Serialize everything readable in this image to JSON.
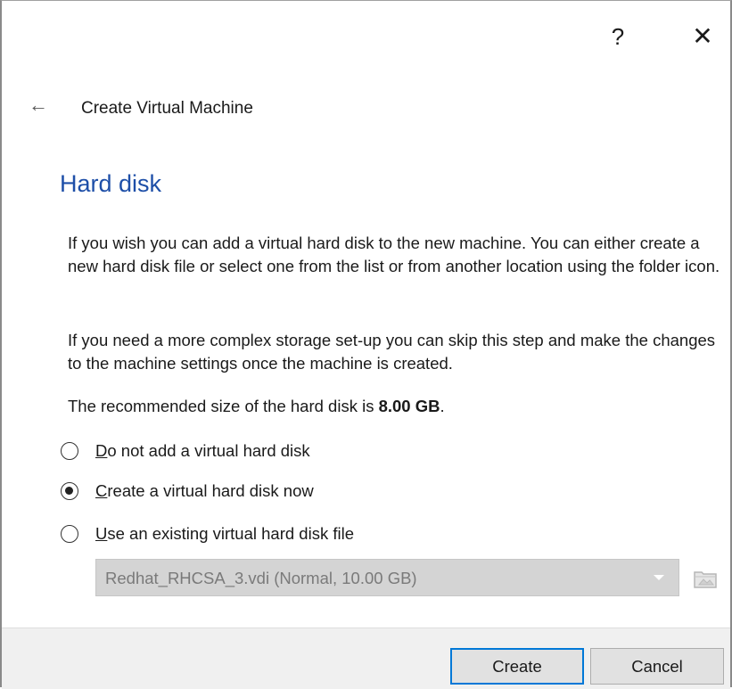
{
  "titlebar": {
    "help_label": "?",
    "close_label": "✕"
  },
  "wizard": {
    "back_icon": "←",
    "title": "Create Virtual Machine"
  },
  "page": {
    "section_title": "Hard disk",
    "paragraph1": "If you wish you can add a virtual hard disk to the new machine. You can either create a new hard disk file or select one from the list or from another location using the folder icon.",
    "paragraph2": "If you need a more complex storage set-up you can skip this step and make the changes to the machine settings once the machine is created.",
    "recommend_prefix": "The recommended size of the hard disk is ",
    "recommend_size": "8.00 GB",
    "recommend_suffix": "."
  },
  "options": [
    {
      "mnemonic": "D",
      "rest": "o not add a virtual hard disk",
      "checked": false
    },
    {
      "mnemonic": "C",
      "rest": "reate a virtual hard disk now",
      "checked": true
    },
    {
      "mnemonic": "U",
      "rest": "se an existing virtual hard disk file",
      "checked": false
    }
  ],
  "existing_disk": {
    "selected": "Redhat_RHCSA_3.vdi (Normal, 10.00 GB)",
    "enabled": false
  },
  "buttons": {
    "create": "Create",
    "cancel": "Cancel"
  },
  "colors": {
    "accent": "#1e4fa8",
    "default_button_border": "#0078d7"
  }
}
